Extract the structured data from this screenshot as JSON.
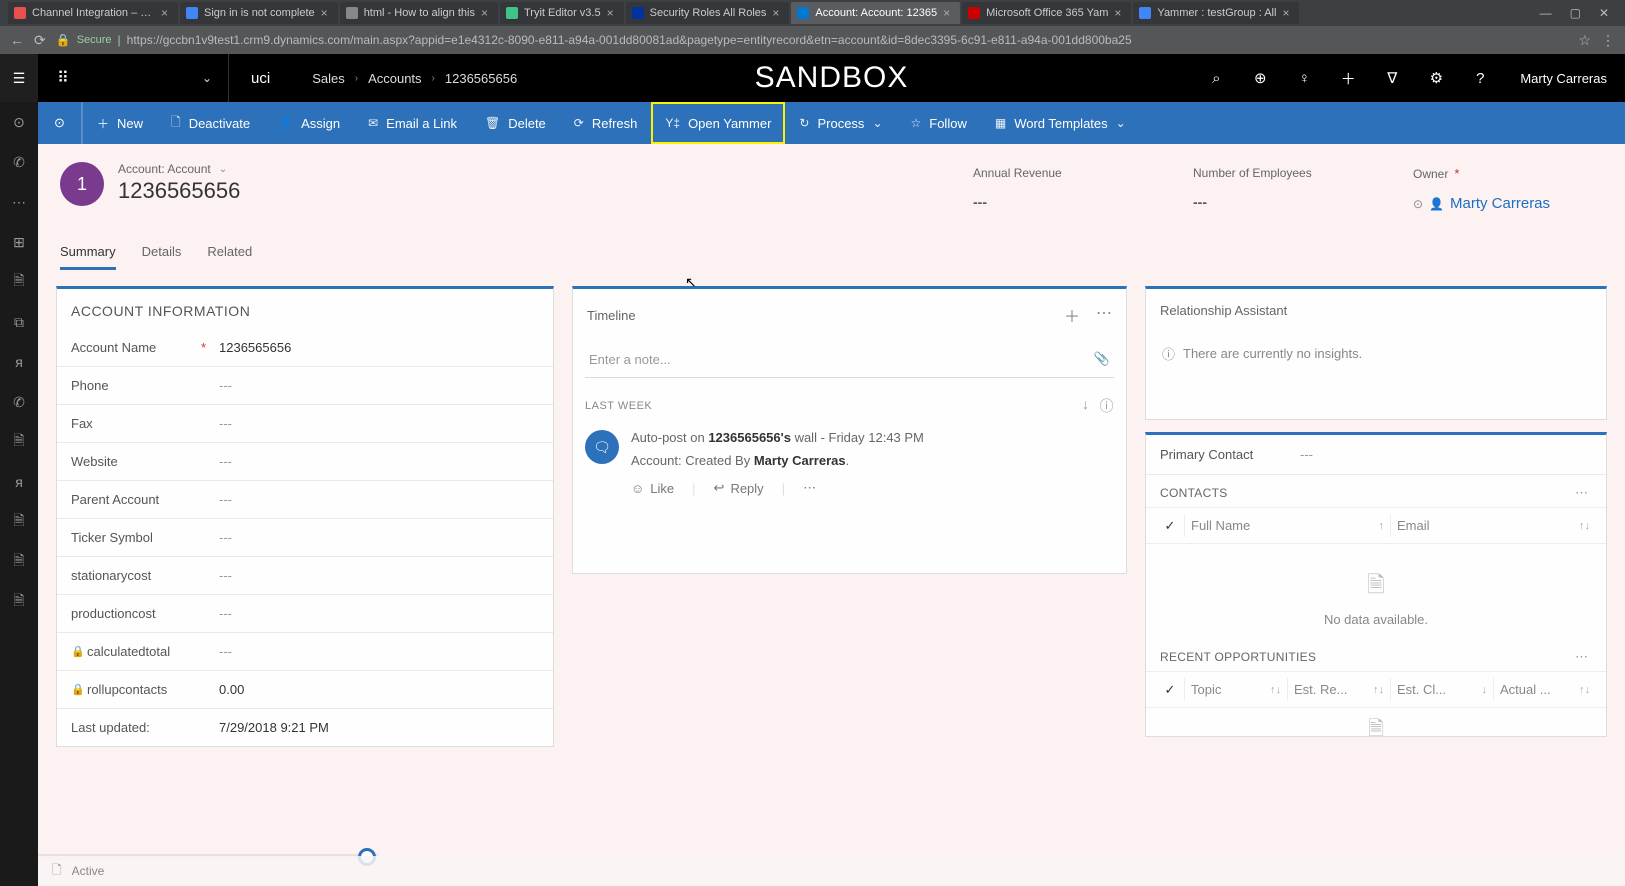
{
  "browser": {
    "tabs": [
      {
        "title": "Channel Integration – Fig"
      },
      {
        "title": "Sign in is not complete"
      },
      {
        "title": "html - How to align this"
      },
      {
        "title": "Tryit Editor v3.5"
      },
      {
        "title": "Security Roles All Roles"
      },
      {
        "title": "Account: Account: 12365"
      },
      {
        "title": "Microsoft Office 365 Yam"
      },
      {
        "title": "Yammer : testGroup : All"
      }
    ],
    "secure_label": "Secure",
    "url": "https://gccbn1v9test1.crm9.dynamics.com/main.aspx?appid=e1e4312c-8090-e811-a94a-001dd80081ad&pagetype=entityrecord&etn=account&id=8dec3395-6c91-e811-a94a-001dd800ba25"
  },
  "topbar": {
    "uci": "uci",
    "crumb_module": "Sales",
    "crumb_entity": "Accounts",
    "crumb_rec": "1236565656",
    "sandbox": "SANDBOX",
    "user": "Marty Carreras"
  },
  "cmd": {
    "new": "New",
    "deactivate": "Deactivate",
    "assign": "Assign",
    "email": "Email a Link",
    "delete": "Delete",
    "refresh": "Refresh",
    "openyammer": "Open Yammer",
    "process": "Process",
    "follow": "Follow",
    "wordtmpl": "Word Templates"
  },
  "record": {
    "type_label": "Account: Account",
    "name": "1236565656",
    "avatar_text": "1",
    "annual_rev_label": "Annual Revenue",
    "annual_rev_val": "---",
    "emp_label": "Number of Employees",
    "emp_val": "---",
    "owner_label": "Owner",
    "owner_val": "Marty Carreras"
  },
  "tabs": {
    "summary": "Summary",
    "details": "Details",
    "related": "Related"
  },
  "account_info": {
    "title": "ACCOUNT INFORMATION",
    "fields": [
      {
        "label": "Account Name",
        "value": "1236565656",
        "required": true
      },
      {
        "label": "Phone",
        "value": "---"
      },
      {
        "label": "Fax",
        "value": "---"
      },
      {
        "label": "Website",
        "value": "---"
      },
      {
        "label": "Parent Account",
        "value": "---"
      },
      {
        "label": "Ticker Symbol",
        "value": "---"
      },
      {
        "label": "stationarycost",
        "value": "---"
      },
      {
        "label": "productioncost",
        "value": "---"
      },
      {
        "label": "calculatedtotal",
        "value": "---",
        "lock": true
      },
      {
        "label": "rollupcontacts",
        "value": "0.00",
        "lock": true
      },
      {
        "label": "Last updated:",
        "value": "7/29/2018 9:21 PM"
      }
    ]
  },
  "timeline": {
    "title": "Timeline",
    "note_ph": "Enter a note...",
    "group": "LAST WEEK",
    "item_prefix": "Auto-post on ",
    "item_rec": "1236565656's",
    "item_suffix": "  wall  -  ",
    "item_time": "Friday 12:43 PM",
    "item_line2_pre": "Account: Created By ",
    "item_line2_user": "Marty Carreras",
    "like": "Like",
    "reply": "Reply"
  },
  "ra": {
    "title": "Relationship Assistant",
    "empty": "There are currently no insights."
  },
  "contacts": {
    "pc_label": "Primary Contact",
    "pc_val": "---",
    "sec": "CONTACTS",
    "col1": "Full Name",
    "col2": "Email",
    "nodata": "No data available."
  },
  "opps": {
    "sec": "RECENT OPPORTUNITIES",
    "c1": "Topic",
    "c2": "Est. Re...",
    "c3": "Est. Cl...",
    "c4": "Actual ..."
  },
  "footer": {
    "status": "Active"
  }
}
